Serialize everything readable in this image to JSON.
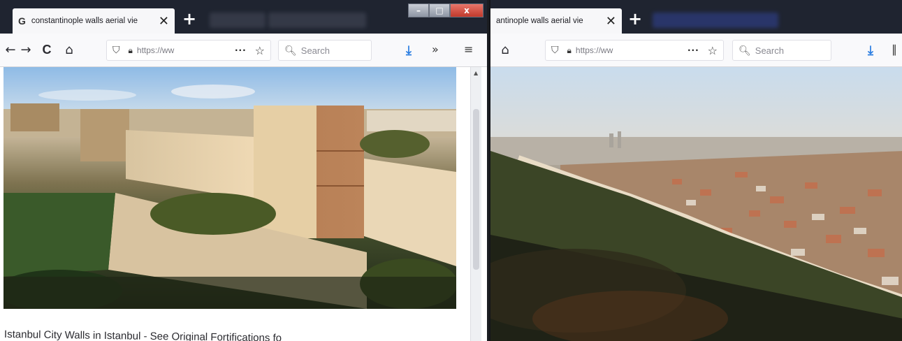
{
  "left_window": {
    "tab_title": "constantinople walls aerial vie",
    "tab_favicon": "G",
    "new_tab_label": "+",
    "window_controls": {
      "minimize": "–",
      "maximize": "□",
      "close": "x"
    },
    "nav": {
      "back": "←",
      "forward": "→",
      "reload": "C",
      "home": "⌂"
    },
    "url": "https://ww",
    "page_actions": "···",
    "search_placeholder": "Search",
    "caption": "Istanbul City Walls in Istanbul - See Original Fortifications fo"
  },
  "right_window": {
    "tab_title": "antinople walls aerial vie",
    "new_tab_label": "+",
    "url": "https://ww",
    "page_actions": "···",
    "search_placeholder": "Search"
  },
  "colors": {
    "download_blue": "#2a7de1",
    "tabstrip_dark": "#1f2430",
    "close_red": "#c0392b"
  }
}
